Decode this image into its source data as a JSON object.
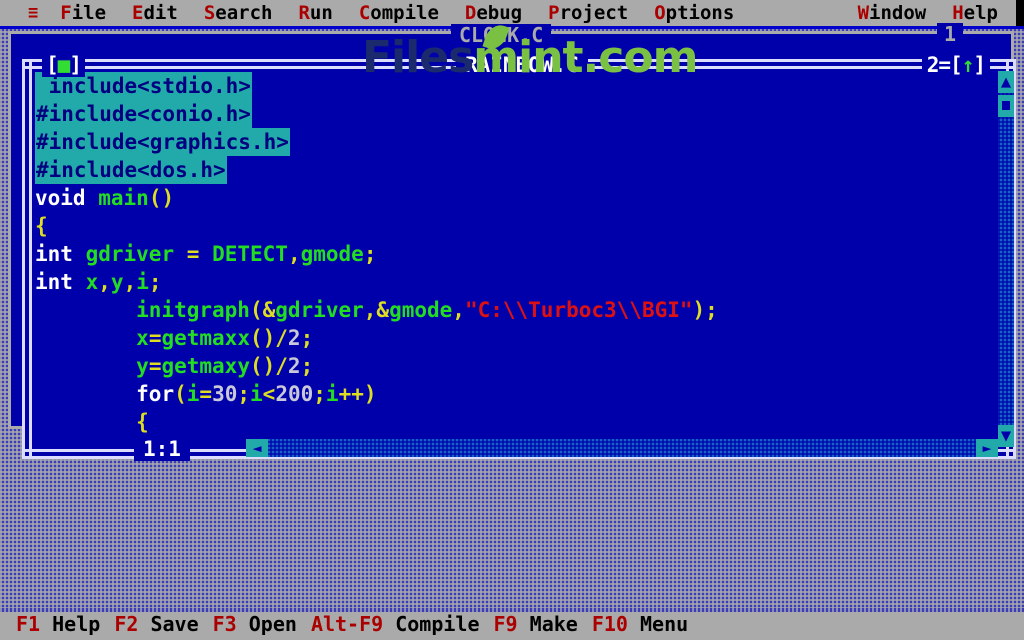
{
  "menubar": {
    "system_icon": "≡",
    "items": [
      {
        "name": "file",
        "hotkey": "F",
        "rest": "ile"
      },
      {
        "name": "edit",
        "hotkey": "E",
        "rest": "dit"
      },
      {
        "name": "search",
        "hotkey": "S",
        "rest": "earch"
      },
      {
        "name": "run",
        "hotkey": "R",
        "rest": "un"
      },
      {
        "name": "compile",
        "hotkey": "C",
        "rest": "ompile"
      },
      {
        "name": "debug",
        "hotkey": "D",
        "rest": "ebug"
      },
      {
        "name": "project",
        "hotkey": "P",
        "rest": "roject"
      },
      {
        "name": "options",
        "hotkey": "O",
        "rest": "ptions"
      }
    ],
    "right_items": [
      {
        "name": "window",
        "hotkey": "W",
        "rest": "indow"
      },
      {
        "name": "help",
        "hotkey": "H",
        "rest": "elp"
      }
    ]
  },
  "window1": {
    "title": "CLOCK.C",
    "number": "1",
    "state": "inactive"
  },
  "window2": {
    "title": "RAINBOW.C",
    "number": "2",
    "close_box": "[■]",
    "close_box_left": "[",
    "close_box_square": "■",
    "close_box_right": "]",
    "zoom_box": "=[↑]",
    "zoom_prefix": "=[",
    "zoom_arrow": "↑",
    "zoom_suffix": "]",
    "state": "active",
    "cursor_position": "1:1"
  },
  "editor": {
    "lines": [
      {
        "selected": true,
        "text": " include<stdio.h>"
      },
      {
        "selected": true,
        "text": "#include<conio.h>"
      },
      {
        "selected": true,
        "text": "#include<graphics.h>"
      },
      {
        "selected": true,
        "text": "#include<dos.h>"
      },
      {
        "selected": false,
        "text": "void main()"
      },
      {
        "selected": false,
        "text": "{"
      },
      {
        "selected": false,
        "text": "int gdriver = DETECT,gmode;"
      },
      {
        "selected": false,
        "text": "int x,y,i;"
      },
      {
        "selected": false,
        "text": "        initgraph(&gdriver,&gmode,\"C:\\\\Turboc3\\\\BGI\");"
      },
      {
        "selected": false,
        "text": "        x=getmaxx()/2;"
      },
      {
        "selected": false,
        "text": "        y=getmaxy()/2;"
      },
      {
        "selected": false,
        "text": "        for(i=30;i<200;i++)"
      },
      {
        "selected": false,
        "text": "        {"
      }
    ],
    "scroll_up_arrow": "▲",
    "scroll_down_arrow": "▼",
    "scroll_left_arrow": "◄",
    "scroll_right_arrow": "►"
  },
  "statusbar": {
    "items": [
      {
        "key": "F1",
        "label": " Help"
      },
      {
        "key": "F2",
        "label": " Save"
      },
      {
        "key": "F3",
        "label": " Open"
      },
      {
        "key": "Alt-F9",
        "label": " Compile"
      },
      {
        "key": "F9",
        "label": " Make"
      },
      {
        "key": "F10",
        "label": " Menu"
      }
    ]
  },
  "watermark": {
    "part_a": "Files",
    "part_b": "mint.com"
  },
  "colors": {
    "menubar_bg": "#aaaaaa",
    "desktop_blue": "#3b3bbb",
    "window_bg": "#0000aa",
    "selection_bg": "#22aaaa",
    "keyword": "#ffffff",
    "identifier": "#22dd22",
    "punctuation": "#dddd22",
    "string": "#dd1111",
    "number": "#c8c8d8",
    "hotkey_red": "#aa0000",
    "scrollbar": "#22aaaa",
    "watermark_green": "#7ac143"
  }
}
